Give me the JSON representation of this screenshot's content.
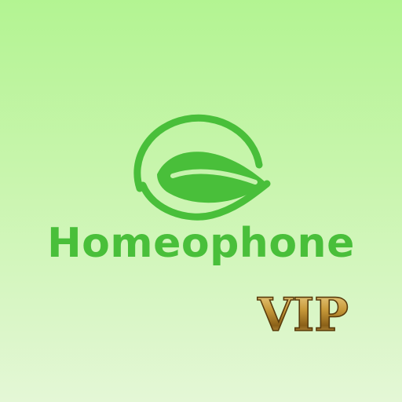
{
  "app": {
    "name": "Homeophone",
    "badge": "VIP"
  },
  "logo": {
    "icon": "leaf-in-circle-icon"
  },
  "colors": {
    "brand_green": "#49bf3a",
    "background_top": "#b3f492",
    "background_bottom": "#e4f7d6",
    "badge_gold_light": "#e9c77a",
    "badge_gold_dark": "#6b4a12"
  }
}
